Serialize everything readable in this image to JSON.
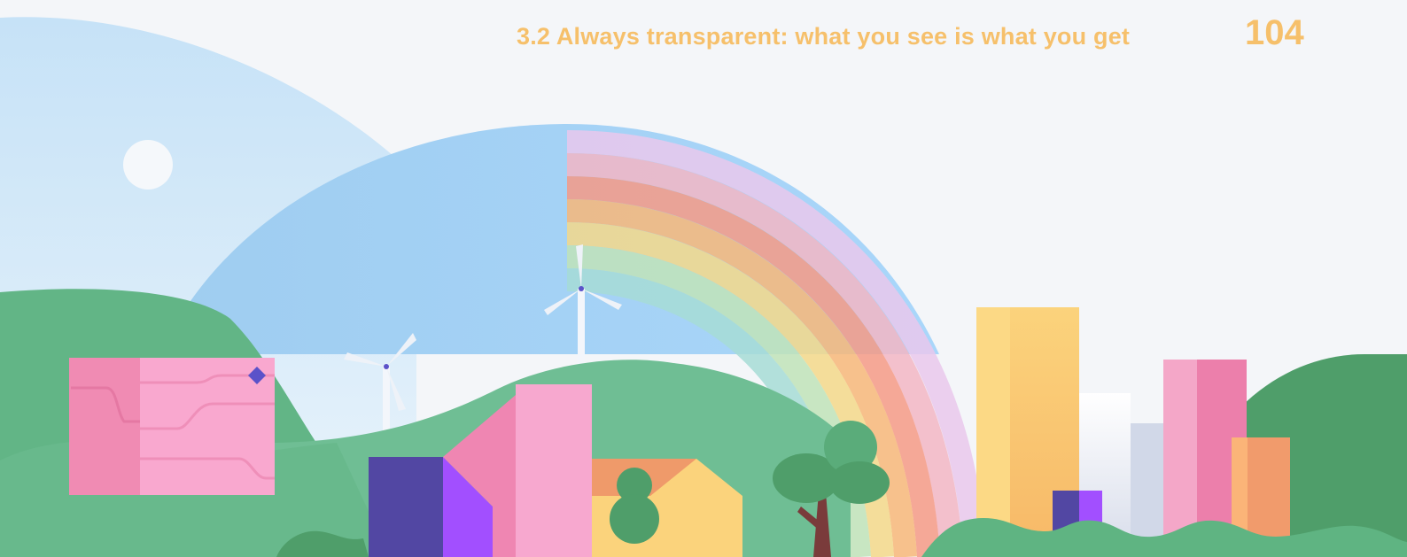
{
  "header": {
    "section_title": "3.2 Always transparent: what you see is what you get",
    "page_number": "104"
  },
  "colors": {
    "accent": "#f6c06b",
    "background": "#f4f6f9",
    "sky": "#a8d4f4",
    "hill_green": "#5fb482",
    "building_pink": "#f3a6c8",
    "building_yellow": "#f9cf7a",
    "building_purple": "#5a4aa8"
  }
}
